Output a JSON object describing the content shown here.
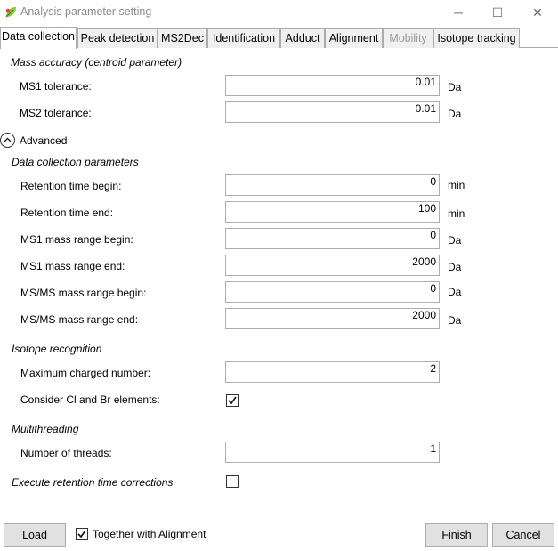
{
  "window": {
    "title": "Analysis parameter setting",
    "icon": "app-leaf-icon",
    "controls": {
      "minimize": "─",
      "maximize": "☐",
      "close": "✕"
    }
  },
  "tabs": [
    {
      "label": "Data collection",
      "active": true
    },
    {
      "label": "Peak detection"
    },
    {
      "label": "MS2Dec"
    },
    {
      "label": "Identification"
    },
    {
      "label": "Adduct"
    },
    {
      "label": "Alignment"
    },
    {
      "label": "Mobility",
      "disabled": true
    },
    {
      "label": "Isotope tracking"
    }
  ],
  "mass_accuracy": {
    "heading": "Mass accuracy (centroid parameter)",
    "ms1_label": "MS1 tolerance:",
    "ms1_value": "0.01",
    "ms1_unit": "Da",
    "ms2_label": "MS2 tolerance:",
    "ms2_value": "0.01",
    "ms2_unit": "Da"
  },
  "advanced": {
    "label": "Advanced",
    "icon": "chevron-up-icon"
  },
  "data_collection": {
    "heading": "Data collection parameters",
    "rt_begin_label": "Retention time begin:",
    "rt_begin_value": "0",
    "rt_begin_unit": "min",
    "rt_end_label": "Retention time end:",
    "rt_end_value": "100",
    "rt_end_unit": "min",
    "ms1_begin_label": "MS1 mass range begin:",
    "ms1_begin_value": "0",
    "ms1_begin_unit": "Da",
    "ms1_end_label": "MS1 mass range end:",
    "ms1_end_value": "2000",
    "ms1_end_unit": "Da",
    "msms_begin_label": "MS/MS mass range begin:",
    "msms_begin_value": "0",
    "msms_begin_unit": "Da",
    "msms_end_label": "MS/MS mass range end:",
    "msms_end_value": "2000",
    "msms_end_unit": "Da"
  },
  "isotope": {
    "heading": "Isotope recognition",
    "max_charge_label": "Maximum charged number:",
    "max_charge_value": "2",
    "cl_br_label": "Consider Cl and Br elements:",
    "cl_br_checked": true
  },
  "multithreading": {
    "heading": "Multithreading",
    "threads_label": "Number of threads:",
    "threads_value": "1"
  },
  "rt_correction": {
    "label": "Execute retention time corrections",
    "checked": false
  },
  "footer": {
    "load_label": "Load",
    "together_label": "Together with Alignment",
    "together_checked": true,
    "finish_label": "Finish",
    "cancel_label": "Cancel"
  }
}
